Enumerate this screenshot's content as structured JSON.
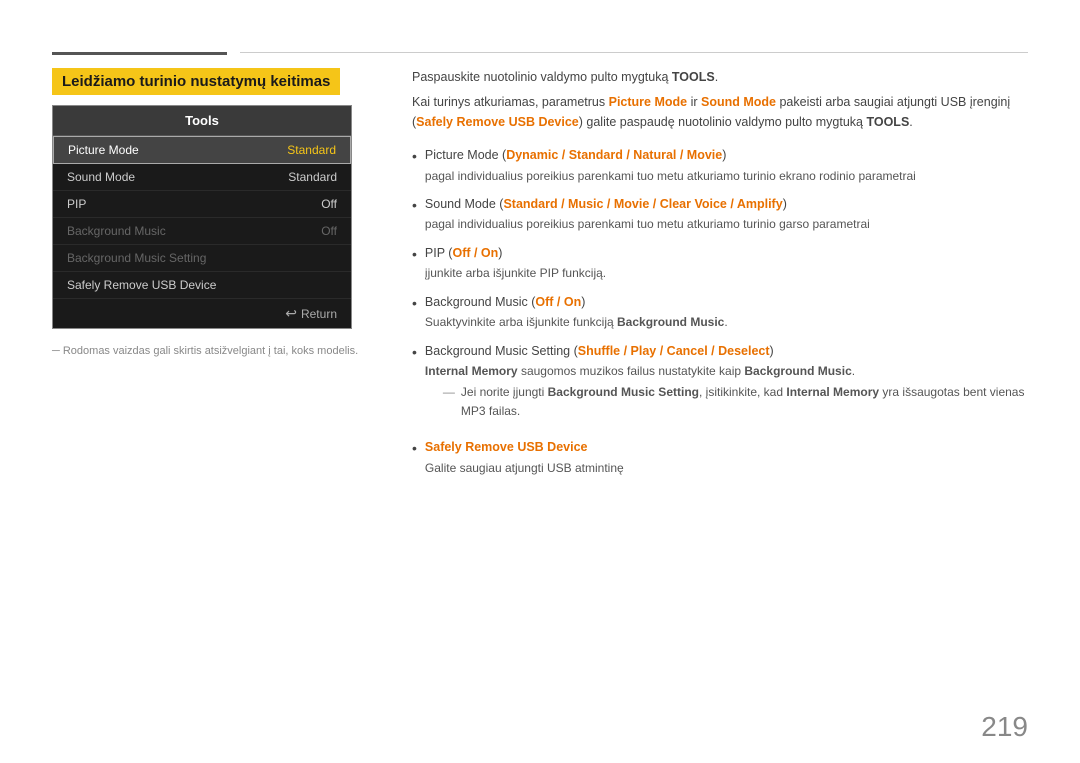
{
  "top": {
    "title": "Leidžiamo turinio nustatymų keitimas"
  },
  "tools_menu": {
    "header": "Tools",
    "items": [
      {
        "label": "Picture Mode",
        "value": "Standard",
        "state": "active"
      },
      {
        "label": "Sound Mode",
        "value": "Standard",
        "state": "normal"
      },
      {
        "label": "PIP",
        "value": "Off",
        "state": "normal"
      },
      {
        "label": "Background Music",
        "value": "Off",
        "state": "dimmed"
      },
      {
        "label": "Background Music Setting",
        "value": "",
        "state": "dimmed"
      },
      {
        "label": "Safely Remove USB Device",
        "value": "",
        "state": "normal"
      }
    ],
    "footer": "Return"
  },
  "footnote": "Rodomas vaizdas gali skirtis atsižvelgiant į tai, koks modelis.",
  "intro1": "Paspauskite nuotolinio valdymo pulto mygtuką TOOLS.",
  "intro1_bold": "TOOLS",
  "intro2_before": "Kai turinys atkuriamas, parametrus ",
  "intro2_bold1": "Picture Mode",
  "intro2_middle": " ir ",
  "intro2_bold2": "Sound Mode",
  "intro2_after": " pakeisti arba saugiai atjungti USB įrenginį (",
  "intro2_link": "Safely Remove USB Device",
  "intro2_end": ") galite paspaudę nuotolinio valdymo pulto mygtuką ",
  "intro2_end_bold": "TOOLS",
  "intro2_dot": ".",
  "bullets": [
    {
      "title_before": "Picture Mode (",
      "title_bold": "Dynamic / Standard / Natural / Movie",
      "title_after": ")",
      "sub": "pagal individualius poreikius parenkami tuo metu atkuriamo turinio ekrano rodinio parametrai"
    },
    {
      "title_before": "Sound Mode (",
      "title_bold": "Standard / Music / Movie / Clear Voice / Amplify",
      "title_after": ")",
      "sub": "pagal individualius poreikius parenkami tuo metu atkuriamo turinio garso parametrai"
    },
    {
      "title_before": "PIP (",
      "title_bold": "Off / On",
      "title_after": ")",
      "sub": "įjunkite arba išjunkite PIP funkciją."
    },
    {
      "title_before": "Background Music (",
      "title_bold": "Off / On",
      "title_after": ")",
      "sub_before": "Suaktyvinkite arba išjunkite funkciją ",
      "sub_bold": "Background Music",
      "sub_after": "."
    },
    {
      "title_before": "Background Music Setting (",
      "title_bold": "Shuffle / Play / Cancel / Deselect",
      "title_after": ")",
      "sub_before": "",
      "sub_part1": "Internal Memory",
      "sub_part2": " saugomos muzikos failus nustatykite kaip ",
      "sub_part3": "Background Music",
      "sub_part4": ".",
      "has_note": true,
      "note_before": "Jei norite įjungti ",
      "note_bold1": "Background Music Setting",
      "note_middle": ", įsitikinkite, kad ",
      "note_bold2": "Internal Memory",
      "note_end": " yra išsaugotas bent vienas MP3 failas."
    },
    {
      "title_bold": "Safely Remove USB Device",
      "title_before": "",
      "title_after": "",
      "sub": "Galite saugiau atjungti USB atmintinę"
    }
  ],
  "page_number": "219"
}
